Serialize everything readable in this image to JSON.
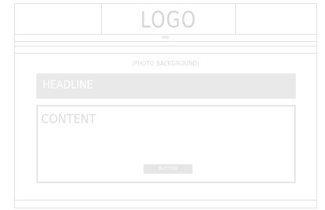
{
  "header": {
    "logo": "LOGO"
  },
  "nav": {
    "label": "NAV"
  },
  "hero": {
    "photo_label": "(PHOTO BACKGROUND)",
    "headline": "HEADLINE"
  },
  "content": {
    "title": "CONTENT",
    "button_label": "BUTTON"
  }
}
